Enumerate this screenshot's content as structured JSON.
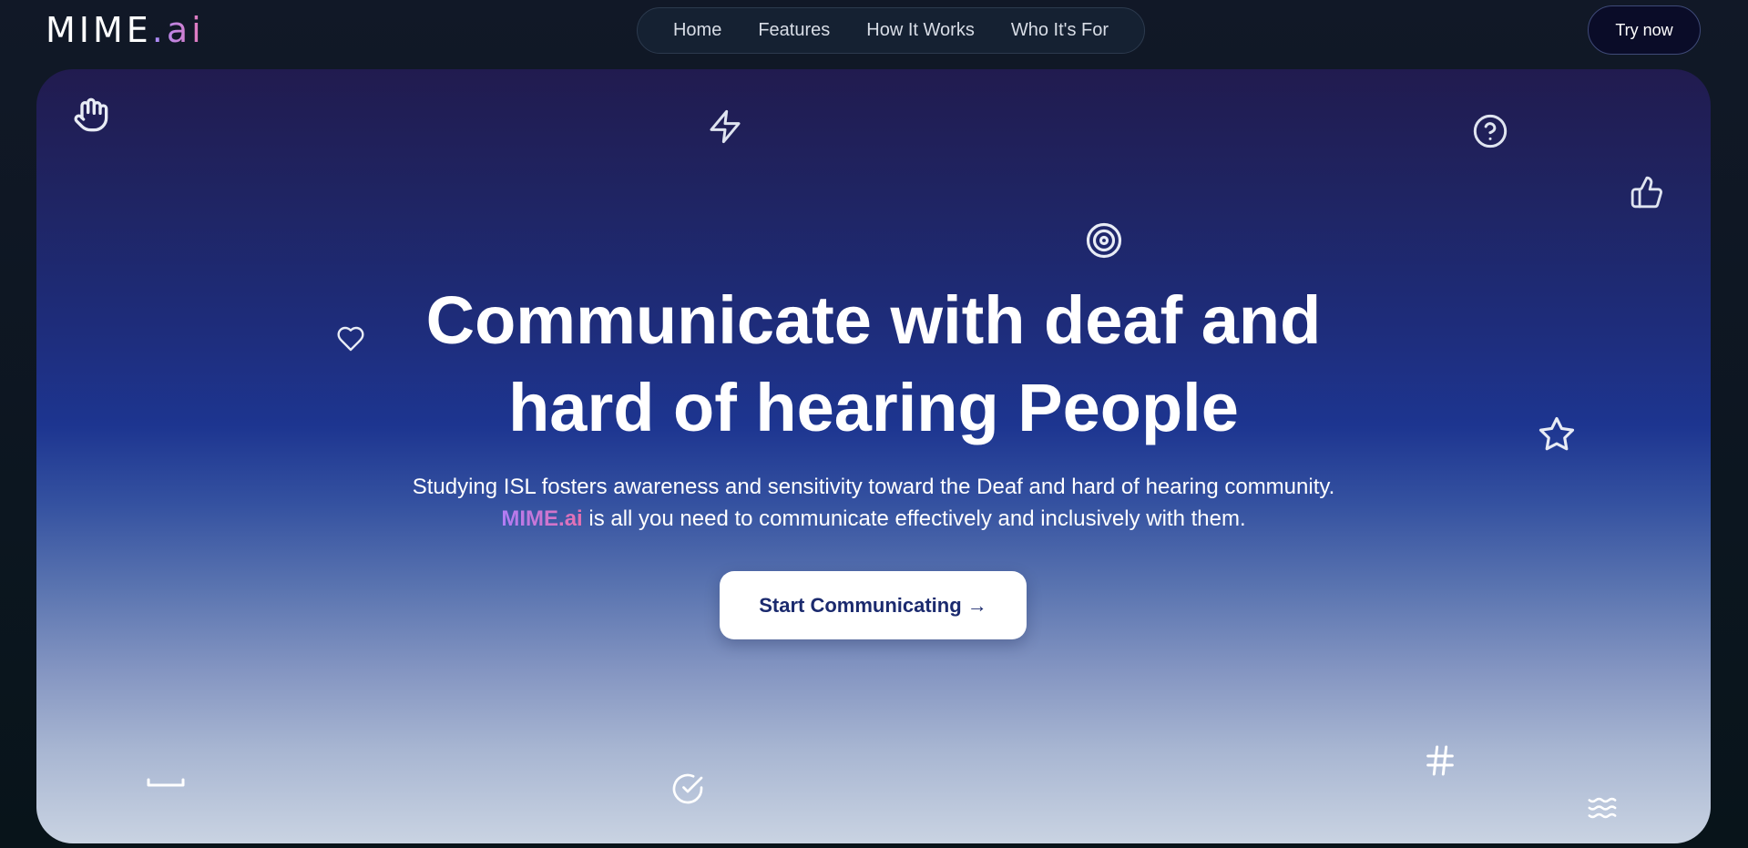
{
  "brand": {
    "name_main": "MIME",
    "name_suffix": ".ai"
  },
  "nav": {
    "items": [
      {
        "label": "Home"
      },
      {
        "label": "Features"
      },
      {
        "label": "How It Works"
      },
      {
        "label": "Who It's For"
      }
    ],
    "cta_label": "Try now"
  },
  "hero": {
    "headline_line1": "Communicate with deaf and",
    "headline_line2": "hard of hearing People",
    "sub_line1": "Studying ISL fosters awareness and sensitivity toward the Deaf and hard of hearing community.",
    "sub_brand": "MIME.ai",
    "sub_line2_rest": " is all you need to communicate effectively and inclusively with them.",
    "cta_label": "Start Communicating →"
  },
  "decorative_icons": [
    "hand-icon",
    "zap-icon",
    "help-circle-icon",
    "thumbs-up-icon",
    "target-icon",
    "heart-icon",
    "star-icon",
    "space-key-icon",
    "check-circle-icon",
    "hash-icon",
    "waves-icon"
  ],
  "colors": {
    "page_bg": "#111827",
    "hero_top": "#211b4f",
    "hero_mid": "#1d3590",
    "hero_bottom": "#c9d3e2",
    "brand_gradient_start": "#a78bfa",
    "brand_gradient_end": "#e879b9",
    "cta_text": "#1b2a6e"
  }
}
